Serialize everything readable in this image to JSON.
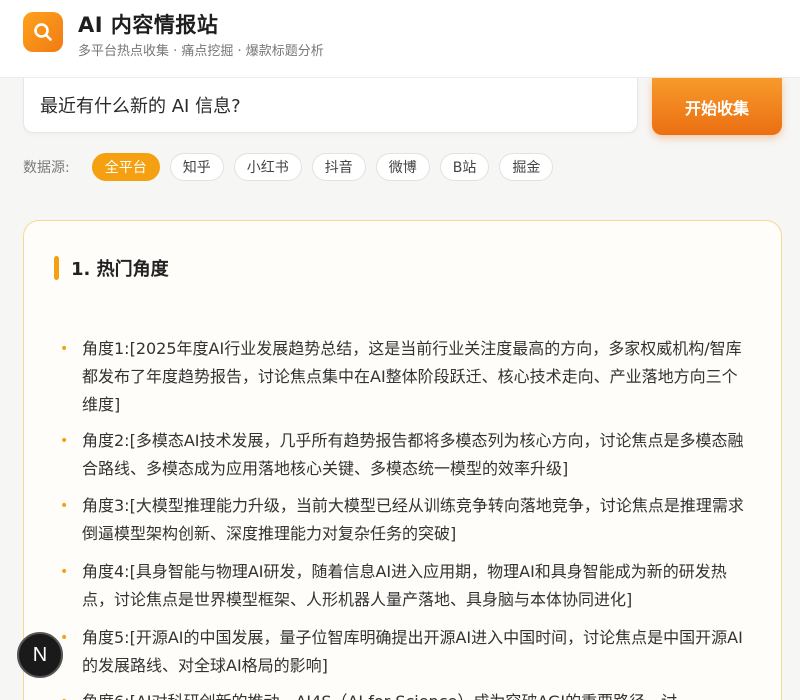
{
  "header": {
    "title": "AI 内容情报站",
    "subtitle": "多平台热点收集 · 痛点挖掘 · 爆款标题分析",
    "logo_icon": "search-icon",
    "accent": "#f07b12"
  },
  "search": {
    "value": "最近有什么新的 AI 信息?",
    "button_label": "开始收集"
  },
  "sources": {
    "label": "数据源:",
    "chips": [
      "全平台",
      "知乎",
      "小红书",
      "抖音",
      "微博",
      "B站",
      "掘金"
    ],
    "active": "全平台"
  },
  "section": {
    "title": "1. 热门角度",
    "items": [
      "角度1:[2025年度AI行业发展趋势总结，这是当前行业关注度最高的方向，多家权威机构/智库都发布了年度趋势报告，讨论焦点集中在AI整体阶段跃迁、核心技术走向、产业落地方向三个维度]",
      "角度2:[多模态AI技术发展，几乎所有趋势报告都将多模态列为核心方向，讨论焦点是多模态融合路线、多模态成为应用落地核心关键、多模态统一模型的效率升级]",
      "角度3:[大模型推理能力升级，当前大模型已经从训练竞争转向落地竞争，讨论焦点是推理需求倒逼模型架构创新、深度推理能力对复杂任务的突破]",
      "角度4:[具身智能与物理AI研发，随着信息AI进入应用期，物理AI和具身智能成为新的研发热点，讨论焦点是世界模型框架、人形机器人量产落地、具身脑与本体协同进化]",
      "角度5:[开源AI的中国发展，量子位智库明确提出开源AI进入中国时间，讨论焦点是中国开源AI的发展路线、对全球AI格局的影响]",
      "角度6:[AI对科研创新的推动，AI4S（AI for Science）成为突破AGI的重要路径，讨"
    ]
  },
  "fab": {
    "label": "N"
  }
}
